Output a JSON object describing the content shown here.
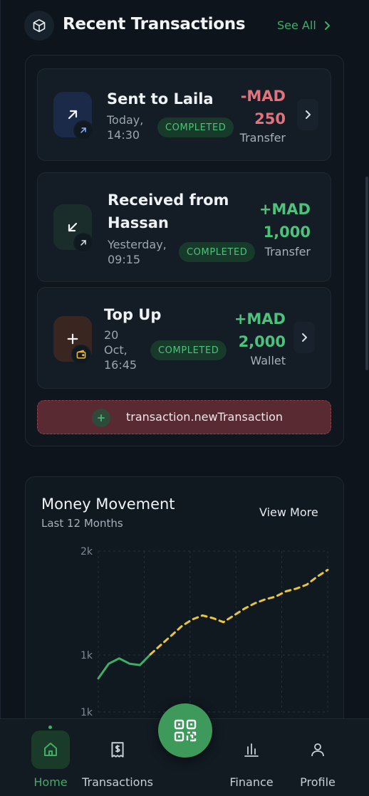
{
  "colors": {
    "accent_green": "#3fae67",
    "negative": "#e0737c",
    "positive": "#4cc27a",
    "status_bg": "#173a2b",
    "new_tx_bg": "#5a2a33"
  },
  "recent": {
    "icon": "cube-icon",
    "title": "Recent Transactions",
    "see_all": "See All"
  },
  "transactions": [
    {
      "name": "Sent to Laila",
      "time_line1": "Today,",
      "time_line2": "14:30",
      "status": "COMPLETED",
      "amount_line1": "-MAD",
      "amount_line2": "250",
      "type": "Transfer",
      "direction": "out",
      "icon": "arrow-up-right-icon"
    },
    {
      "name_line1": "Received from",
      "name_line2": "Hassan",
      "time_line1": "Yesterday,",
      "time_line2": "09:15",
      "status": "COMPLETED",
      "amount_line1": "+MAD",
      "amount_line2": "1,000",
      "type": "Transfer",
      "direction": "in",
      "icon": "arrow-down-left-icon"
    },
    {
      "name": "Top Up",
      "time_line1": "20",
      "time_line2": "Oct,",
      "time_line3": "16:45",
      "status": "COMPLETED",
      "amount_line1": "+MAD",
      "amount_line2": "2,000",
      "type": "Wallet",
      "direction": "in",
      "icon": "plus-icon"
    }
  ],
  "new_transaction": {
    "label": "transaction.newTransaction"
  },
  "money_movement": {
    "title": "Money Movement",
    "subtitle": "Last 12 Months",
    "view_more": "View More"
  },
  "chart_data": {
    "type": "line",
    "title": "Money Movement",
    "subtitle": "Last 12 Months",
    "y_tick_labels": [
      "2k",
      "1k",
      "1k"
    ],
    "ylim": [
      800,
      2000
    ],
    "grid": true,
    "series": [
      {
        "style": "solid",
        "color": "#3fae67",
        "x": [
          0,
          0.5,
          1,
          1.5,
          2,
          2.5
        ],
        "y": [
          1050,
          1160,
          1200,
          1160,
          1150,
          1230
        ]
      },
      {
        "style": "dashed",
        "color": "#e8c53a",
        "x": [
          2.5,
          3,
          3.5,
          4,
          4.5,
          5,
          5.5,
          6,
          6.5,
          7,
          7.5,
          8,
          8.5,
          9,
          9.5,
          10,
          10.5,
          11
        ],
        "y": [
          1230,
          1300,
          1370,
          1440,
          1490,
          1520,
          1500,
          1470,
          1520,
          1570,
          1610,
          1640,
          1660,
          1700,
          1720,
          1750,
          1810,
          1860
        ]
      }
    ]
  },
  "nav": {
    "items": [
      {
        "label": "Home",
        "icon": "home-icon",
        "active": true
      },
      {
        "label": "Transactions",
        "icon": "receipt-icon",
        "active": false
      },
      {
        "label": "Finance",
        "icon": "bar-chart-icon",
        "active": false
      },
      {
        "label": "Profile",
        "icon": "user-icon",
        "active": false
      }
    ],
    "center_action": "qr-code-icon"
  }
}
